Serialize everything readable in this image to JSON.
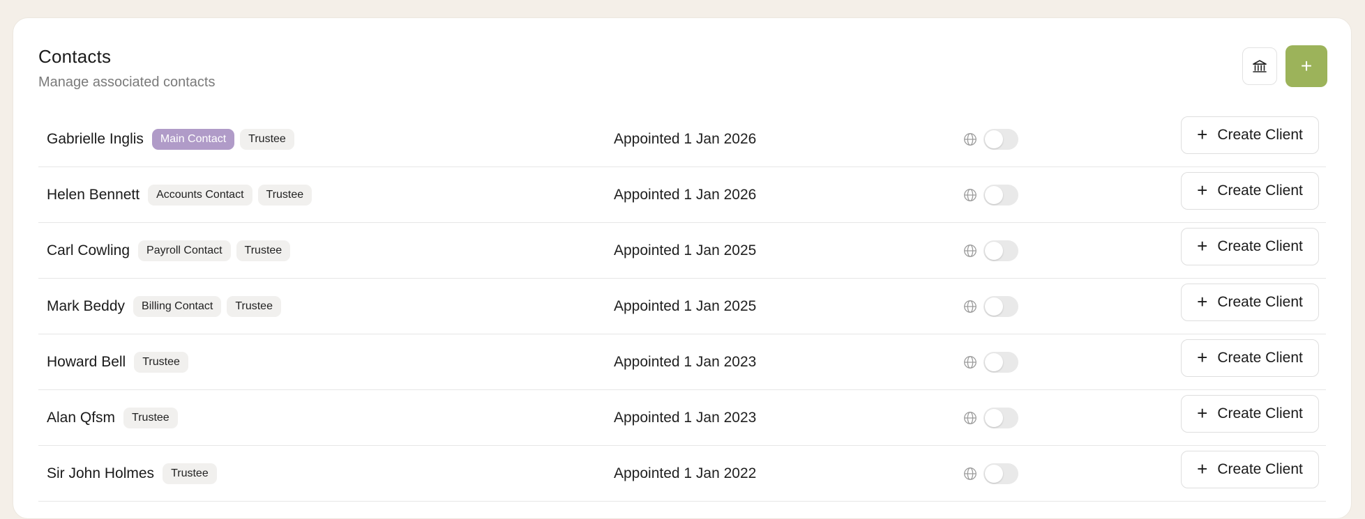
{
  "header": {
    "title": "Contacts",
    "subtitle": "Manage associated contacts",
    "bank_icon": "bank-icon",
    "add_label": "+"
  },
  "colors": {
    "accent": "#9cb35a",
    "main_badge": "#b09bc8",
    "background": "#f4efe8"
  },
  "row_action_label": "Create Client",
  "contacts": [
    {
      "name": "Gabrielle Inglis",
      "badges": [
        {
          "text": "Main Contact",
          "type": "main"
        },
        {
          "text": "Trustee",
          "type": "default"
        }
      ],
      "appointed": "Appointed 1 Jan 2026",
      "portal_enabled": false
    },
    {
      "name": "Helen Bennett",
      "badges": [
        {
          "text": "Accounts Contact",
          "type": "default"
        },
        {
          "text": "Trustee",
          "type": "default"
        }
      ],
      "appointed": "Appointed 1 Jan 2026",
      "portal_enabled": false
    },
    {
      "name": "Carl Cowling",
      "badges": [
        {
          "text": "Payroll Contact",
          "type": "default"
        },
        {
          "text": "Trustee",
          "type": "default"
        }
      ],
      "appointed": "Appointed 1 Jan 2025",
      "portal_enabled": false
    },
    {
      "name": "Mark Beddy",
      "badges": [
        {
          "text": "Billing Contact",
          "type": "default"
        },
        {
          "text": "Trustee",
          "type": "default"
        }
      ],
      "appointed": "Appointed 1 Jan 2025",
      "portal_enabled": false
    },
    {
      "name": "Howard Bell",
      "badges": [
        {
          "text": "Trustee",
          "type": "default"
        }
      ],
      "appointed": "Appointed 1 Jan 2023",
      "portal_enabled": false
    },
    {
      "name": "Alan Qfsm",
      "badges": [
        {
          "text": "Trustee",
          "type": "default"
        }
      ],
      "appointed": "Appointed 1 Jan 2023",
      "portal_enabled": false
    },
    {
      "name": "Sir John Holmes",
      "badges": [
        {
          "text": "Trustee",
          "type": "default"
        }
      ],
      "appointed": "Appointed 1 Jan 2022",
      "portal_enabled": false
    }
  ]
}
